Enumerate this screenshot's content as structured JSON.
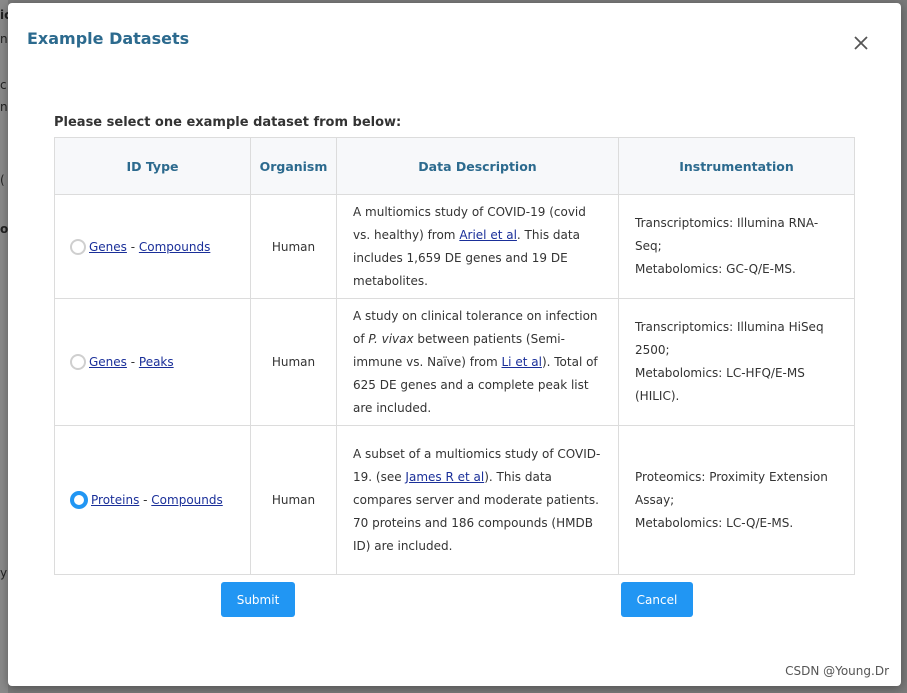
{
  "background": {
    "fragments": [
      "ic",
      "n",
      "c",
      "n",
      "(",
      "or",
      "y"
    ]
  },
  "modal": {
    "title": "Example Datasets",
    "close_label": "×",
    "instruction": "Please select one example dataset from below:",
    "columns": [
      "ID Type",
      "Organism",
      "Data Description",
      "Instrumentation"
    ],
    "rows": [
      {
        "selected": false,
        "id_link1": "Genes",
        "id_sep": " - ",
        "id_link2": "Compounds",
        "organism": "Human",
        "desc_pre": "A multiomics study of COVID-19 (covid vs. healthy) from ",
        "desc_link": "Ariel et al",
        "desc_post": ". This data includes 1,659 DE genes and 19 DE metabolites.",
        "instr_line1": "Transcriptomics: Illumina RNA-Seq;",
        "instr_line2": "Metabolomics: GC-Q/E-MS."
      },
      {
        "selected": false,
        "id_link1": "Genes",
        "id_sep": " - ",
        "id_link2": "Peaks",
        "organism": "Human",
        "desc_pre": "A study on clinical tolerance on infection of ",
        "desc_italic": "P. vivax",
        "desc_mid": " between patients (Semi-immune vs. Naïve) from ",
        "desc_link": "Li et al",
        "desc_post": "). Total of 625 DE genes and a complete peak list are included.",
        "instr_line1": "Transcriptomics: Illumina HiSeq 2500;",
        "instr_line2": "Metabolomics: LC-HFQ/E-MS (HILIC)."
      },
      {
        "selected": true,
        "id_link1": "Proteins",
        "id_sep": " - ",
        "id_link2": "Compounds",
        "organism": "Human",
        "desc_pre": "A subset of a multiomics study of COVID-19. (see ",
        "desc_link": "James R et al",
        "desc_post": "). This data compares server and moderate patients. 70 proteins and 186 compounds (HMDB ID) are included.",
        "instr_line1": "Proteomics: Proximity Extension Assay;",
        "instr_line2": "Metabolomics: LC-Q/E-MS."
      }
    ],
    "submit_label": "Submit",
    "cancel_label": "Cancel"
  },
  "watermark": "CSDN @Young.Dr",
  "colors": {
    "title": "#2c6a8e",
    "primary_button": "#2196f3",
    "link": "#1a2f99",
    "overlay": "#6b6b6b"
  },
  "icons": {
    "close": "close-icon",
    "radio_unselected": "radio-unchecked-icon",
    "radio_selected": "radio-checked-icon"
  }
}
